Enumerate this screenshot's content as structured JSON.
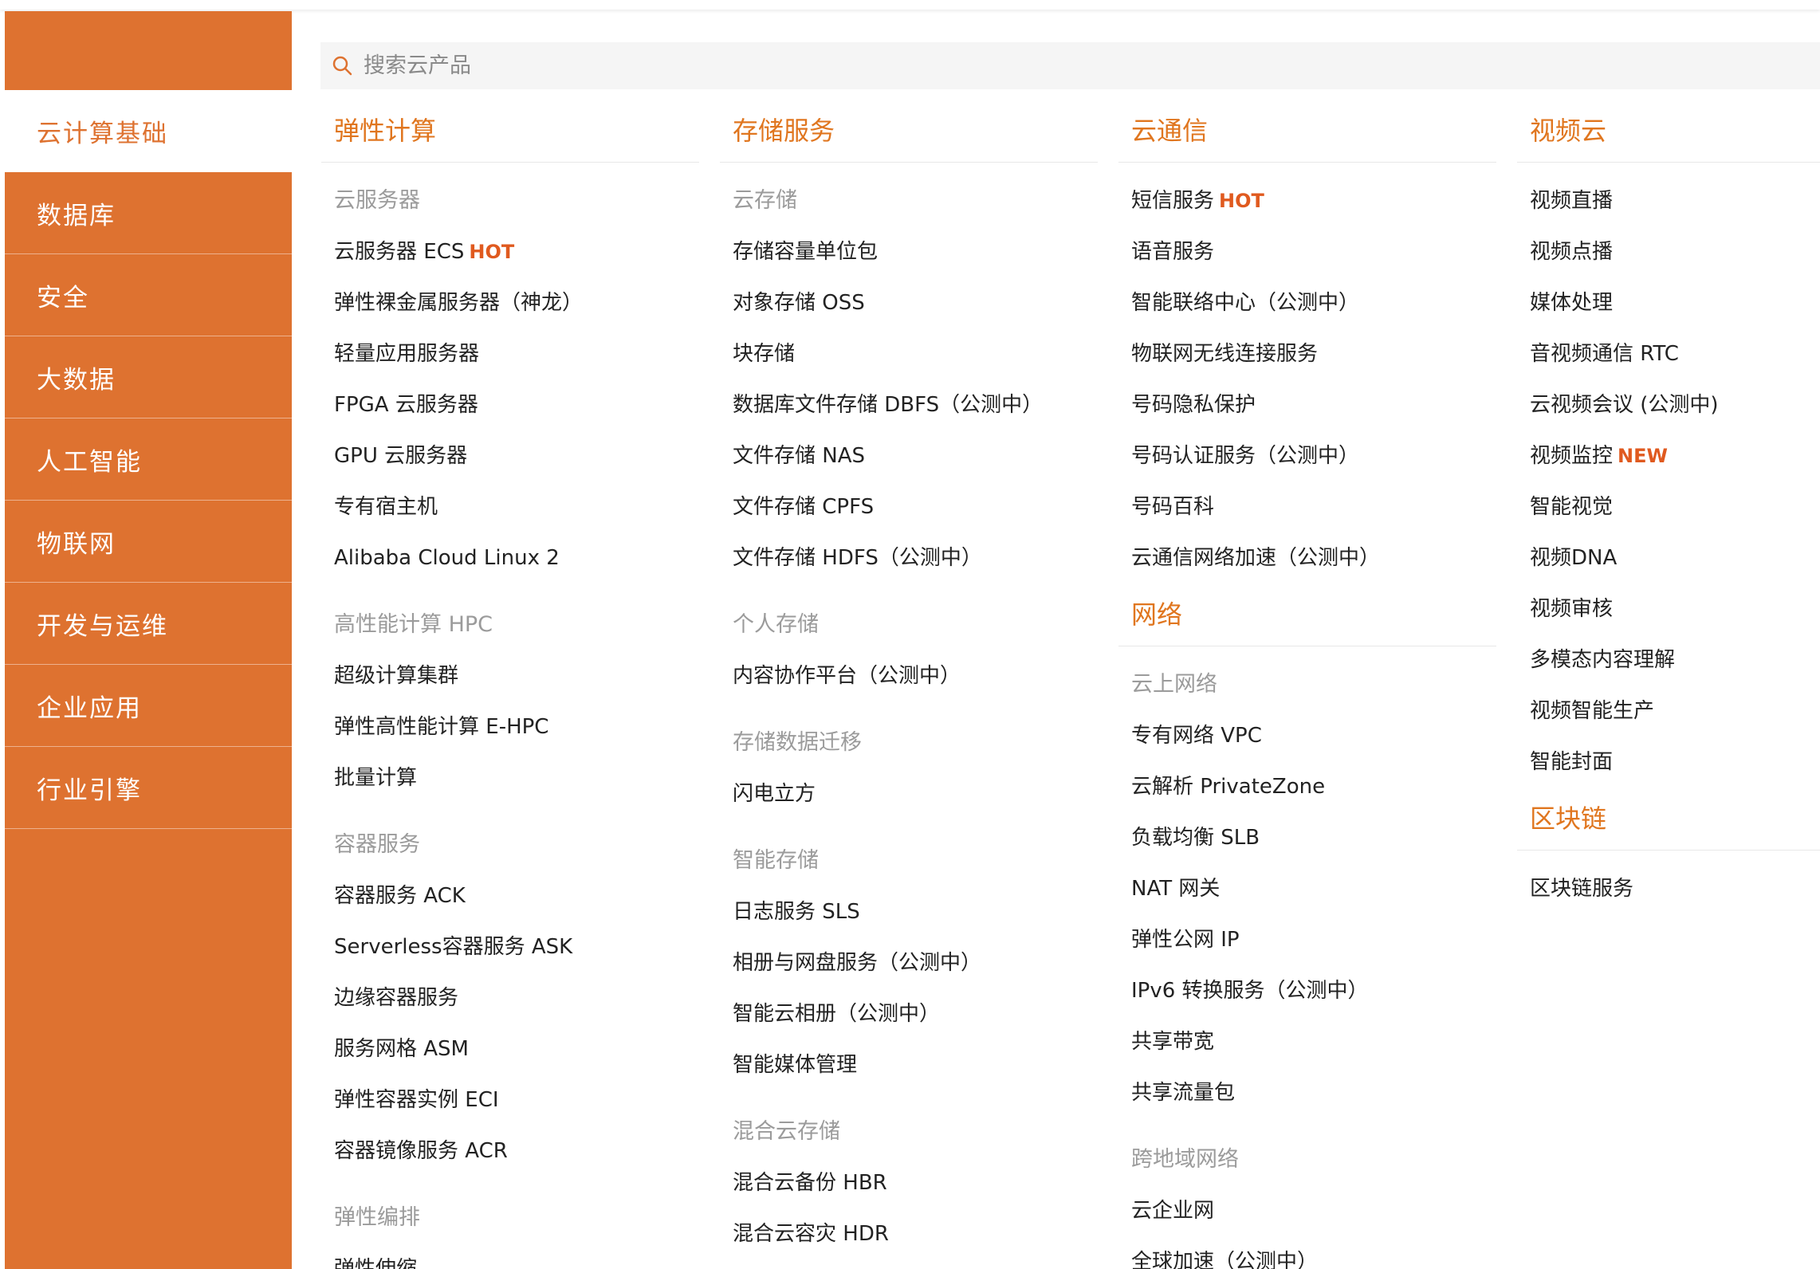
{
  "search": {
    "placeholder": "搜索云产品"
  },
  "sidebar": {
    "items": [
      {
        "label": "云计算基础"
      },
      {
        "label": "数据库"
      },
      {
        "label": "安全"
      },
      {
        "label": "大数据"
      },
      {
        "label": "人工智能"
      },
      {
        "label": "物联网"
      },
      {
        "label": "开发与运维"
      },
      {
        "label": "企业应用"
      },
      {
        "label": "行业引擎"
      }
    ]
  },
  "col1": {
    "title": "弹性计算",
    "groups": [
      {
        "title": "云服务器",
        "items": [
          "云服务器 ECS",
          "弹性裸金属服务器（神龙）",
          "轻量应用服务器",
          "FPGA 云服务器",
          "GPU 云服务器",
          "专有宿主机",
          "Alibaba Cloud Linux 2"
        ],
        "badge0": "HOT"
      },
      {
        "title": "高性能计算 HPC",
        "items": [
          "超级计算集群",
          "弹性高性能计算 E-HPC",
          "批量计算"
        ]
      },
      {
        "title": "容器服务",
        "items": [
          "容器服务 ACK",
          "Serverless容器服务 ASK",
          "边缘容器服务",
          "服务网格 ASM",
          "弹性容器实例 ECI",
          "容器镜像服务 ACR"
        ]
      },
      {
        "title": "弹性编排",
        "items": [
          "弹性伸缩"
        ]
      }
    ]
  },
  "col2": {
    "title": "存储服务",
    "groups": [
      {
        "title": "云存储",
        "items": [
          "存储容量单位包",
          "对象存储 OSS",
          "块存储",
          "数据库文件存储 DBFS（公测中）",
          "文件存储 NAS",
          "文件存储 CPFS",
          "文件存储 HDFS（公测中）"
        ]
      },
      {
        "title": "个人存储",
        "items": [
          "内容协作平台（公测中）"
        ]
      },
      {
        "title": "存储数据迁移",
        "items": [
          "闪电立方"
        ]
      },
      {
        "title": "智能存储",
        "items": [
          "日志服务 SLS",
          "相册与网盘服务（公测中）",
          "智能云相册（公测中）",
          "智能媒体管理"
        ]
      },
      {
        "title": "混合云存储",
        "items": [
          "混合云备份 HBR",
          "混合云容灾 HDR"
        ]
      }
    ]
  },
  "col3": {
    "title": "云通信",
    "items": [
      "短信服务",
      "语音服务",
      "智能联络中心（公测中）",
      "物联网无线连接服务",
      "号码隐私保护",
      "号码认证服务（公测中）",
      "号码百科",
      "云通信网络加速（公测中）"
    ],
    "badge0": "HOT",
    "title2": "网络",
    "groups": [
      {
        "title": "云上网络",
        "items": [
          "专有网络 VPC",
          "云解析 PrivateZone",
          "负载均衡 SLB",
          "NAT 网关",
          "弹性公网 IP",
          "IPv6 转换服务（公测中）",
          "共享带宽",
          "共享流量包"
        ]
      },
      {
        "title": "跨地域网络",
        "items": [
          "云企业网",
          "全球加速（公测中）"
        ]
      }
    ]
  },
  "col4": {
    "title": "视频云",
    "items": [
      "视频直播",
      "视频点播",
      "媒体处理",
      "音视频通信 RTC",
      "云视频会议 (公测中)",
      "视频监控",
      "智能视觉",
      "视频DNA",
      "视频审核",
      "多模态内容理解",
      "视频智能生产",
      "智能封面"
    ],
    "badge5": "NEW",
    "title2": "区块链",
    "items2": [
      "区块链服务"
    ]
  },
  "colors": {
    "accent": "#de7230",
    "badge": "#e05a1f"
  }
}
